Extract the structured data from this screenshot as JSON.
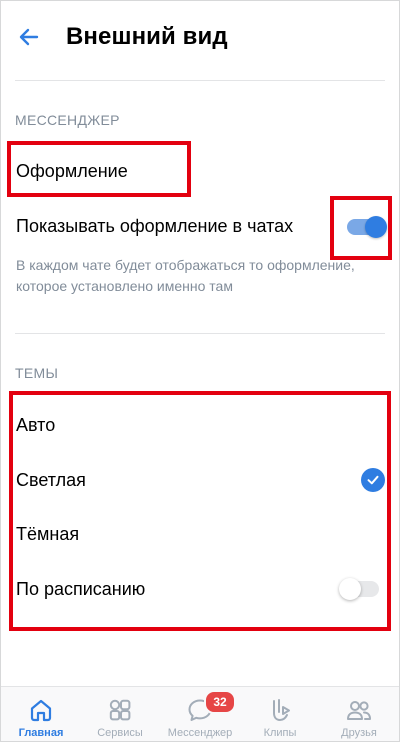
{
  "header": {
    "title": "Внешний вид"
  },
  "messenger_section": {
    "title": "МЕССЕНДЖЕР",
    "appearance_label": "Оформление",
    "show_in_chats_label": "Показывать оформление в чатах",
    "show_in_chats_enabled": true,
    "description": "В каждом чате будет отображаться то оформление, которое установлено именно там"
  },
  "themes_section": {
    "title": "ТЕМЫ",
    "options": [
      {
        "label": "Авто",
        "selected": false
      },
      {
        "label": "Светлая",
        "selected": true
      },
      {
        "label": "Тёмная",
        "selected": false
      },
      {
        "label": "По расписанию",
        "toggle": false
      }
    ]
  },
  "tabbar": {
    "tabs": [
      {
        "label": "Главная",
        "icon": "home-icon",
        "active": true
      },
      {
        "label": "Сервисы",
        "icon": "services-grid-icon",
        "active": false
      },
      {
        "label": "Мессенджер",
        "icon": "messenger-icon",
        "active": false,
        "badge": "32"
      },
      {
        "label": "Клипы",
        "icon": "clips-icon",
        "active": false
      },
      {
        "label": "Друзья",
        "icon": "friends-icon",
        "active": false
      }
    ]
  },
  "colors": {
    "accent": "#2f7de1",
    "secondary_text": "#818c99",
    "highlight_box": "#e3000f",
    "badge": "#e64646"
  }
}
